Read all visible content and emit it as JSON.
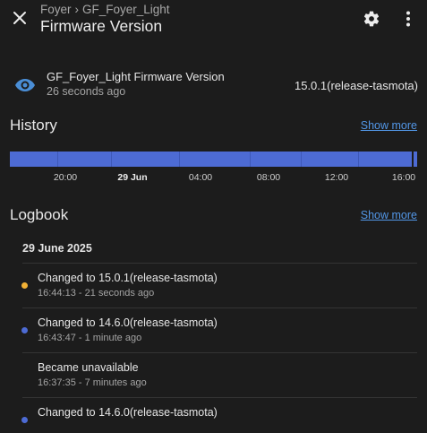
{
  "header": {
    "breadcrumb": [
      "Foyer",
      "GF_Foyer_Light"
    ],
    "breadcrumb_separator": "›",
    "title": "Firmware Version"
  },
  "entity": {
    "name": "GF_Foyer_Light Firmware Version",
    "last_changed": "26 seconds ago",
    "state": "15.0.1(release-tasmota)",
    "icon": "eye-icon",
    "icon_color": "#4a8ed6"
  },
  "history": {
    "title": "History",
    "show_more": "Show more",
    "bar_color": "#4d6bd4",
    "axis_labels": [
      "20:00",
      "29 Jun",
      "04:00",
      "08:00",
      "12:00",
      "16:00"
    ]
  },
  "logbook": {
    "title": "Logbook",
    "show_more": "Show more",
    "date": "29 June 2025",
    "entries": [
      {
        "message": "Changed to 15.0.1(release-tasmota)",
        "time": "16:44:13 - 21 seconds ago",
        "dot_color": "#f2b135"
      },
      {
        "message": "Changed to 14.6.0(release-tasmota)",
        "time": "16:43:47 - 1 minute ago",
        "dot_color": "#4d6bd4"
      },
      {
        "message": "Became unavailable",
        "time": "16:37:35 - 7 minutes ago",
        "dot_color": ""
      },
      {
        "message": "Changed to 14.6.0(release-tasmota)",
        "time": "",
        "dot_color": "#4d6bd4"
      }
    ]
  },
  "colors": {
    "background": "#1c1c1c",
    "link": "#5296e6"
  }
}
